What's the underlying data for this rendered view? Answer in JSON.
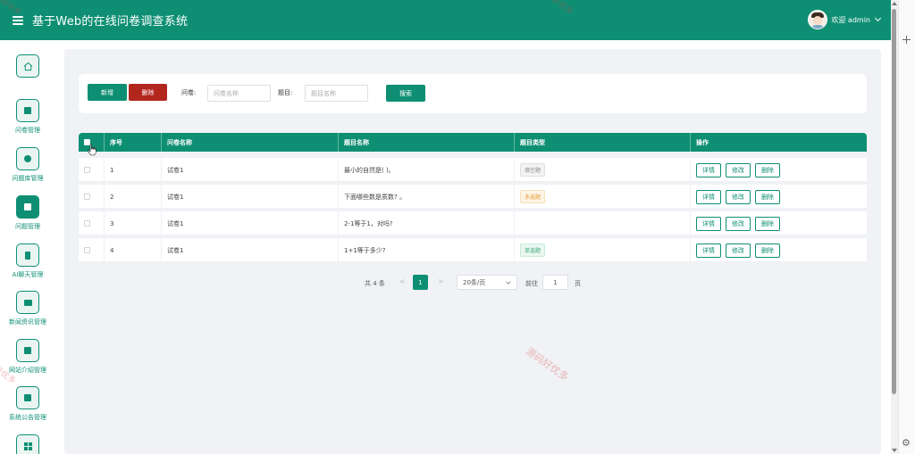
{
  "header": {
    "title": "基于Web的在线问卷调查系统",
    "welcome": "欢迎 admin"
  },
  "sidebar": {
    "items": [
      {
        "label": "",
        "icon": "home-icon",
        "active": false
      },
      {
        "label": "问卷管理",
        "icon": "gift-icon",
        "active": false
      },
      {
        "label": "问题库管理",
        "icon": "clock-icon",
        "active": false
      },
      {
        "label": "问题管理",
        "icon": "calendar-icon",
        "active": true
      },
      {
        "label": "AI聊天管理",
        "icon": "server-icon",
        "active": false
      },
      {
        "label": "新闻资讯管理",
        "icon": "image-icon",
        "active": false
      },
      {
        "label": "网站介绍管理",
        "icon": "window-icon",
        "active": false
      },
      {
        "label": "系统公告管理",
        "icon": "notice-icon",
        "active": false
      },
      {
        "label": "",
        "icon": "grid-icon",
        "active": false
      }
    ]
  },
  "toolbar": {
    "add_label": "新增",
    "delete_label": "删除",
    "questionnaire_label": "问卷:",
    "questionnaire_placeholder": "问卷名称",
    "question_label": "题目:",
    "question_placeholder": "题目名称",
    "search_label": "搜索"
  },
  "table": {
    "columns": [
      "序号",
      "问卷名称",
      "题目名称",
      "题目类型",
      "操作"
    ],
    "rows": [
      {
        "index": "1",
        "questionnaire": "试卷1",
        "question": "最小的自然是( )。",
        "type": "填空题",
        "type_style": "fill"
      },
      {
        "index": "2",
        "questionnaire": "试卷1",
        "question": "下面哪些数是质数? 。",
        "type": "多选题",
        "type_style": "multi"
      },
      {
        "index": "3",
        "questionnaire": "试卷1",
        "question": "2-1等于1，对吗?",
        "type": "",
        "type_style": "none"
      },
      {
        "index": "4",
        "questionnaire": "试卷1",
        "question": "1+1等于多少?",
        "type": "单选题",
        "type_style": "single"
      }
    ],
    "actions": {
      "detail": "详情",
      "edit": "修改",
      "delete": "删除"
    }
  },
  "pagination": {
    "total": "共 4 条",
    "prev": "<",
    "current": "1",
    "next": ">",
    "page_size": "20条/页",
    "goto_label": "前往",
    "goto_value": "1",
    "page_suffix": "页"
  },
  "watermarks": [
    "源码好优多",
    "源码好优多",
    "源码好优多",
    "源码好优多"
  ],
  "colors": {
    "primary": "#0e8f74",
    "danger": "#b3261e",
    "background": "#f0f2f5"
  }
}
